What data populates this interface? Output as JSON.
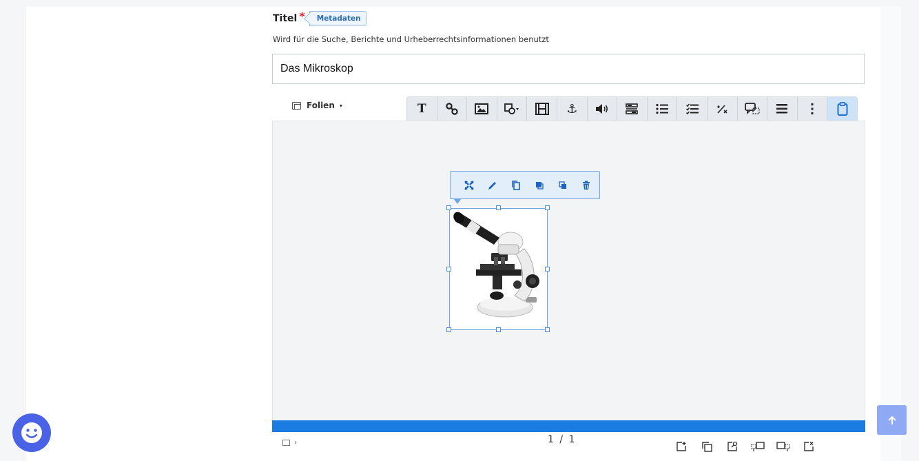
{
  "field": {
    "title_label": "Titel",
    "required_mark": "*",
    "metadata_tag": "Metadaten",
    "hint": "Wird für die Suche, Berichte und Urheberrechtsinformationen benutzt",
    "title_value": "Das Mikroskop"
  },
  "editor": {
    "slides_menu_label": "Folien",
    "slides_menu_caret": "▾",
    "toolbar_icons": [
      "text-icon",
      "link-icon",
      "image-icon",
      "shape-icon",
      "video-icon",
      "anchor-icon",
      "audio-icon",
      "slider-icon",
      "list-icon",
      "checklist-icon",
      "fraction-icon",
      "speech-bubble-icon",
      "menu-icon",
      "more-vertical-icon",
      "clipboard-icon"
    ],
    "active_tool": "clipboard-icon",
    "context_toolbar_icons": [
      "fullscreen-icon",
      "edit-pencil-icon",
      "copy-icon",
      "bring-to-front-icon",
      "send-to-back-icon",
      "delete-icon"
    ],
    "selected_element": "microscope-image",
    "page_indicator": "1 / 1",
    "bottom_tools": [
      "add-slide-icon",
      "duplicate-slide-icon",
      "slide-settings-icon",
      "move-slide-left-icon",
      "move-slide-right-icon",
      "delete-slide-icon"
    ]
  },
  "colors": {
    "accent": "#1a7be0",
    "required": "#e0262b",
    "chat_button": "#4a63e6",
    "scroll_top_button": "#8fa9f5"
  }
}
